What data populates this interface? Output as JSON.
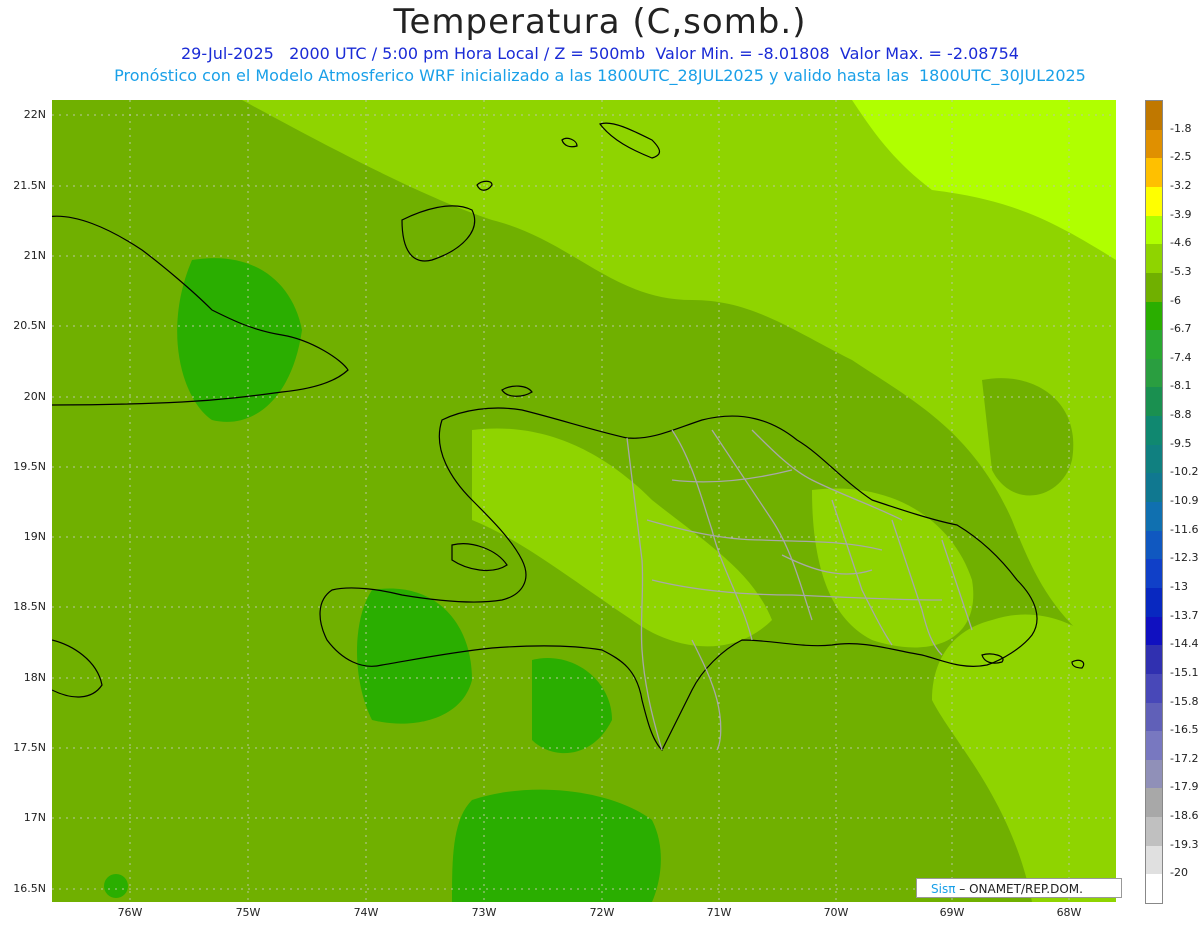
{
  "title": "Temperatura (C,somb.)",
  "subtitle_line1": "29-Jul-2025   2000 UTC / 5:00 pm Hora Local / Z = 500mb  Valor Min. = -8.01808  Valor Max. = -2.08754",
  "subtitle_line2": "Pronóstico con el Modelo Atmosferico WRF inicializado a las 1800UTC_28JUL2025 y valido hasta las  1800UTC_30JUL2025",
  "lat_labels": [
    "22N",
    "21.5N",
    "21N",
    "20.5N",
    "20N",
    "19.5N",
    "19N",
    "18.5N",
    "18N",
    "17.5N",
    "17N",
    "16.5N"
  ],
  "lon_labels": [
    "76W",
    "75W",
    "74W",
    "73W",
    "72W",
    "71W",
    "70W",
    "69W",
    "68W"
  ],
  "colorbar": {
    "labels": [
      "-1.8",
      "-2.5",
      "-3.2",
      "-3.9",
      "-4.6",
      "-5.3",
      "-6",
      "-6.7",
      "-7.4",
      "-8.1",
      "-8.8",
      "-9.5",
      "-10.2",
      "-10.9",
      "-11.6",
      "-12.3",
      "-13",
      "-13.7",
      "-14.4",
      "-15.1",
      "-15.8",
      "-16.5",
      "-17.2",
      "-17.9",
      "-18.6",
      "-19.3",
      "-20"
    ],
    "colors": [
      "#c07800",
      "#e09000",
      "#ffc000",
      "#ffff00",
      "#b0ff00",
      "#8fd400",
      "#70b000",
      "#2aae00",
      "#2aa830",
      "#2a9e40",
      "#1a9050",
      "#108870",
      "#108080",
      "#107890",
      "#1070b0",
      "#1058c0",
      "#1040c8",
      "#0828c0",
      "#1010c0",
      "#3030b0",
      "#4848b8",
      "#6060b8",
      "#7878c0",
      "#9090b8",
      "#a8a8a8",
      "#c0c0c0",
      "#e0e0e0",
      "#ffffff"
    ]
  },
  "footer": {
    "logo_text": "Sisπ",
    "credit": " – ONAMET/REP.DOM."
  }
}
